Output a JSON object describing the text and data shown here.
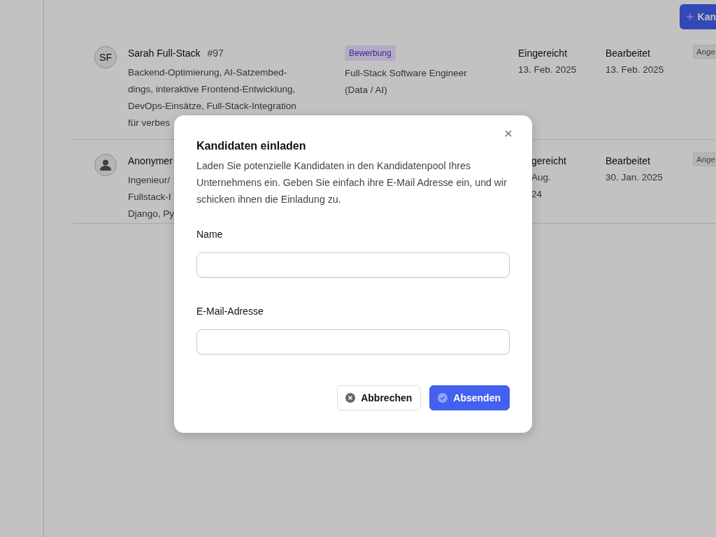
{
  "header_button": {
    "label": "Kan"
  },
  "rows": [
    {
      "avatar": {
        "kind": "initials",
        "text": "SF"
      },
      "name": "Sarah Full-Stack",
      "number": "#97",
      "description_lines": [
        "Backend-Optimierung, AI-Satzembed-",
        "dings, interaktive Frontend-Entwicklung,",
        "DevOps-Einsätze, Full-Stack-Integration",
        "für verbes"
      ],
      "tag": "Bewerbung",
      "position": "Full-Stack Software Engineer (Data / AI)",
      "submitted_label": "Eingereicht",
      "submitted_lines": [
        "13. Feb. 2025"
      ],
      "edited_label": "Bearbeitet",
      "edited": "13. Feb. 2025",
      "status": "Ange"
    },
    {
      "avatar": {
        "kind": "person"
      },
      "name": "Anonymer",
      "description_lines": [
        "Ingenieur/",
        "Fullstack-I",
        "Django, Py"
      ],
      "submitted_label": "gereicht",
      "submitted_lines": [
        "Aug.",
        "24"
      ],
      "edited_label": "Bearbeitet",
      "edited": "30. Jan. 2025",
      "status": "Ange"
    }
  ],
  "dialog": {
    "title": "Kandidaten einladen",
    "description": "Laden Sie potenzielle Kandidaten in den Kandidatenpool Ihres Unternehmens ein. Geben Sie einfach ihre E-Mail Adresse ein, und wir schicken ihnen die Einladung zu.",
    "fields": [
      {
        "label": "Name"
      },
      {
        "label": "E-Mail-Adresse"
      }
    ],
    "buttons": [
      {
        "kind": "cancel",
        "label": "Abbrechen"
      },
      {
        "kind": "submit",
        "label": "Absenden"
      }
    ]
  }
}
